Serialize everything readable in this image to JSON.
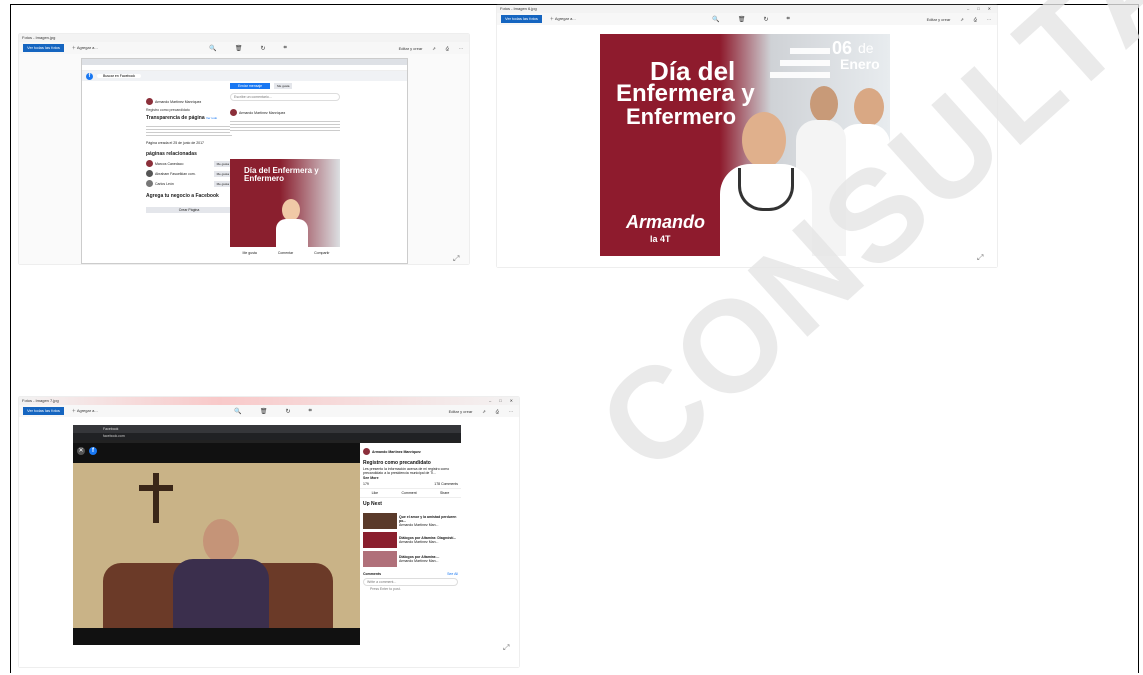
{
  "colors": {
    "accent": "#1565c0",
    "poster_bg": "#8e1b2d",
    "fb_blue": "#1877f2",
    "watermark": "#e6e6e6"
  },
  "watermark": "CONSULTA",
  "windows": [
    {
      "title": "Fotos - Imagen.jpg",
      "toolbar": {
        "all_photos": "Ver todas las fotos",
        "add": "Agregar a...",
        "edit": "Editar y crear"
      },
      "controls": [
        "–",
        "□",
        "✕"
      ]
    },
    {
      "title": "Fotos - Imagen 6.jpg",
      "toolbar": {
        "all_photos": "Ver todas las fotos",
        "add": "Agregar a...",
        "edit": "Editar y crear"
      },
      "controls": [
        "–",
        "□",
        "✕"
      ]
    },
    {
      "title": "Fotos - Imagen 7.jpg",
      "toolbar": {
        "all_photos": "Ver todas las fotos",
        "add": "Agregar a...",
        "edit": "Editar y crear"
      },
      "controls": [
        "–",
        "□",
        "✕"
      ]
    }
  ],
  "fb_page": {
    "search_placeholder": "Buscar en Facebook",
    "author": "Armando Martínez Manríquez",
    "post_text": "Registro como precandidato",
    "transparency": "Transparencia de página",
    "transparency_link": "Ver todo",
    "created": "Página creada el 25 de junio de 2017",
    "related_title": "páginas relacionadas",
    "related": [
      {
        "name": "Marcos Canedaco",
        "btn": "Me gusta"
      },
      {
        "name": "Abraham Fasuelkian com.",
        "btn": "Me gusta"
      },
      {
        "name": "Carlos León",
        "btn": "Me gusta"
      }
    ],
    "add_title": "Agrega tu negocio a Facebook",
    "create_btn": "Crear Página",
    "send_msg": "Enviar mensaje",
    "comment_placeholder": "Escribe un comentario...",
    "post_author": "Armando Martínez Manríquez",
    "mini_poster": "Día del Enfermera y Enfermero",
    "like": "Me gusta",
    "comment": "Comentar",
    "share": "Compartir"
  },
  "poster": {
    "date_num": "06",
    "date_de": "de",
    "date_month": "Enero",
    "line1": "Día del",
    "line2": "Enfermera y",
    "line3": "Enfermero",
    "logo": "Armando",
    "logo_sub": "la 4T"
  },
  "video_page": {
    "tab": "Facebook",
    "url": "facebook.com",
    "author": "Armando Martínez Manríquez",
    "title": "Registro como precandidato",
    "desc": "Les presento la información acerca de mi registro como precandidato a la presidencia municipal de Ti...",
    "see_more": "See More",
    "count": "179",
    "comments_count": "178 Comments",
    "like": "Like",
    "comment": "Comment",
    "share": "Share",
    "up_next": "Up Next",
    "next": [
      {
        "title": "Que el amor y la amistad perduren po...",
        "author": "Armando Martínez Man..."
      },
      {
        "title": "Diálogos por Altamira: Diagnóstí...",
        "author": "Armando Martínez Man..."
      },
      {
        "title": "Diálogos por Altamira:...",
        "author": "Armando Martínez Man..."
      }
    ],
    "comments_label": "Comments",
    "see_all": "See All",
    "comment_placeholder": "Write a comment...",
    "press_enter": "Press Enter to post."
  }
}
